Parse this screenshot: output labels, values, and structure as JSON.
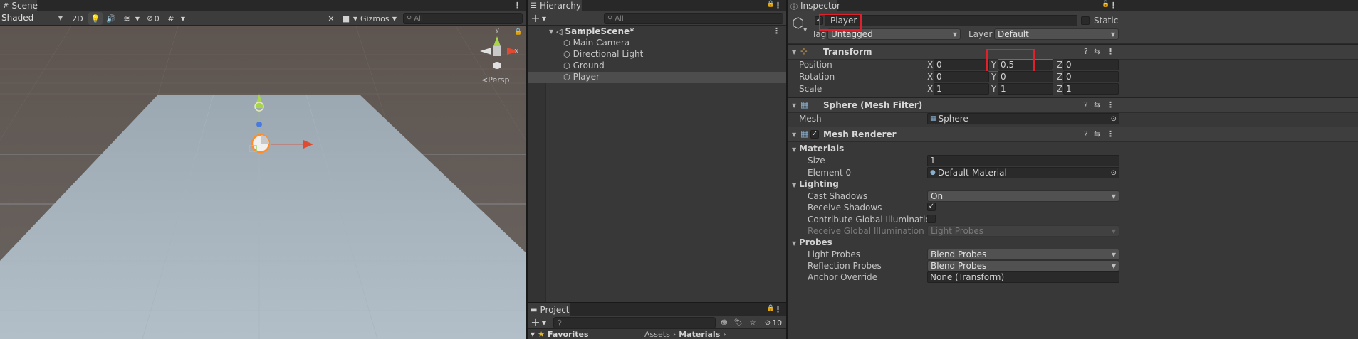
{
  "scene": {
    "tab_label": "Scene",
    "draw_mode": "Shaded",
    "mode_2d": "2D",
    "hidden_count": "0",
    "gizmos_label": "Gizmos",
    "search_placeholder": "All",
    "gizmo_y_label": "y",
    "gizmo_x_label": "x",
    "persp_label": "Persp"
  },
  "hierarchy": {
    "tab_label": "Hierarchy",
    "search_placeholder": "All",
    "scene_name": "SampleScene*",
    "items": [
      {
        "label": "Main Camera"
      },
      {
        "label": "Directional Light"
      },
      {
        "label": "Ground"
      },
      {
        "label": "Player"
      }
    ]
  },
  "project": {
    "tab_label": "Project",
    "hidden_count": "10",
    "favorites_label": "Favorites",
    "breadcrumb": [
      "Assets",
      "Materials"
    ]
  },
  "inspector": {
    "tab_label": "Inspector",
    "object_name": "Player",
    "static_label": "Static",
    "tag_label": "Tag",
    "tag_value": "Untagged",
    "layer_label": "Layer",
    "layer_value": "Default",
    "transform": {
      "title": "Transform",
      "position_label": "Position",
      "rotation_label": "Rotation",
      "scale_label": "Scale",
      "axis_x": "X",
      "axis_y": "Y",
      "axis_z": "Z",
      "position": {
        "x": "0",
        "y": "0.5",
        "z": "0"
      },
      "rotation": {
        "x": "0",
        "y": "0",
        "z": "0"
      },
      "scale": {
        "x": "1",
        "y": "1",
        "z": "1"
      }
    },
    "mesh_filter": {
      "title": "Sphere (Mesh Filter)",
      "mesh_label": "Mesh",
      "mesh_value": "Sphere"
    },
    "mesh_renderer": {
      "title": "Mesh Renderer",
      "materials_label": "Materials",
      "size_label": "Size",
      "size_value": "1",
      "element0_label": "Element 0",
      "element0_value": "Default-Material",
      "lighting_label": "Lighting",
      "cast_shadows_label": "Cast Shadows",
      "cast_shadows_value": "On",
      "receive_shadows_label": "Receive Shadows",
      "receive_shadows_checked": true,
      "contribute_gi_label": "Contribute Global Illumination",
      "contribute_gi_checked": false,
      "receive_gi_label": "Receive Global Illumination",
      "receive_gi_value": "Light Probes",
      "probes_label": "Probes",
      "light_probes_label": "Light Probes",
      "light_probes_value": "Blend Probes",
      "reflection_probes_label": "Reflection Probes",
      "reflection_probes_value": "Blend Probes",
      "anchor_override_label": "Anchor Override",
      "anchor_override_value": "None (Transform)"
    }
  },
  "colors": {
    "highlight_red": "#e0202a",
    "selection": "#4d4d4d",
    "field_focus": "#3a79bb"
  }
}
